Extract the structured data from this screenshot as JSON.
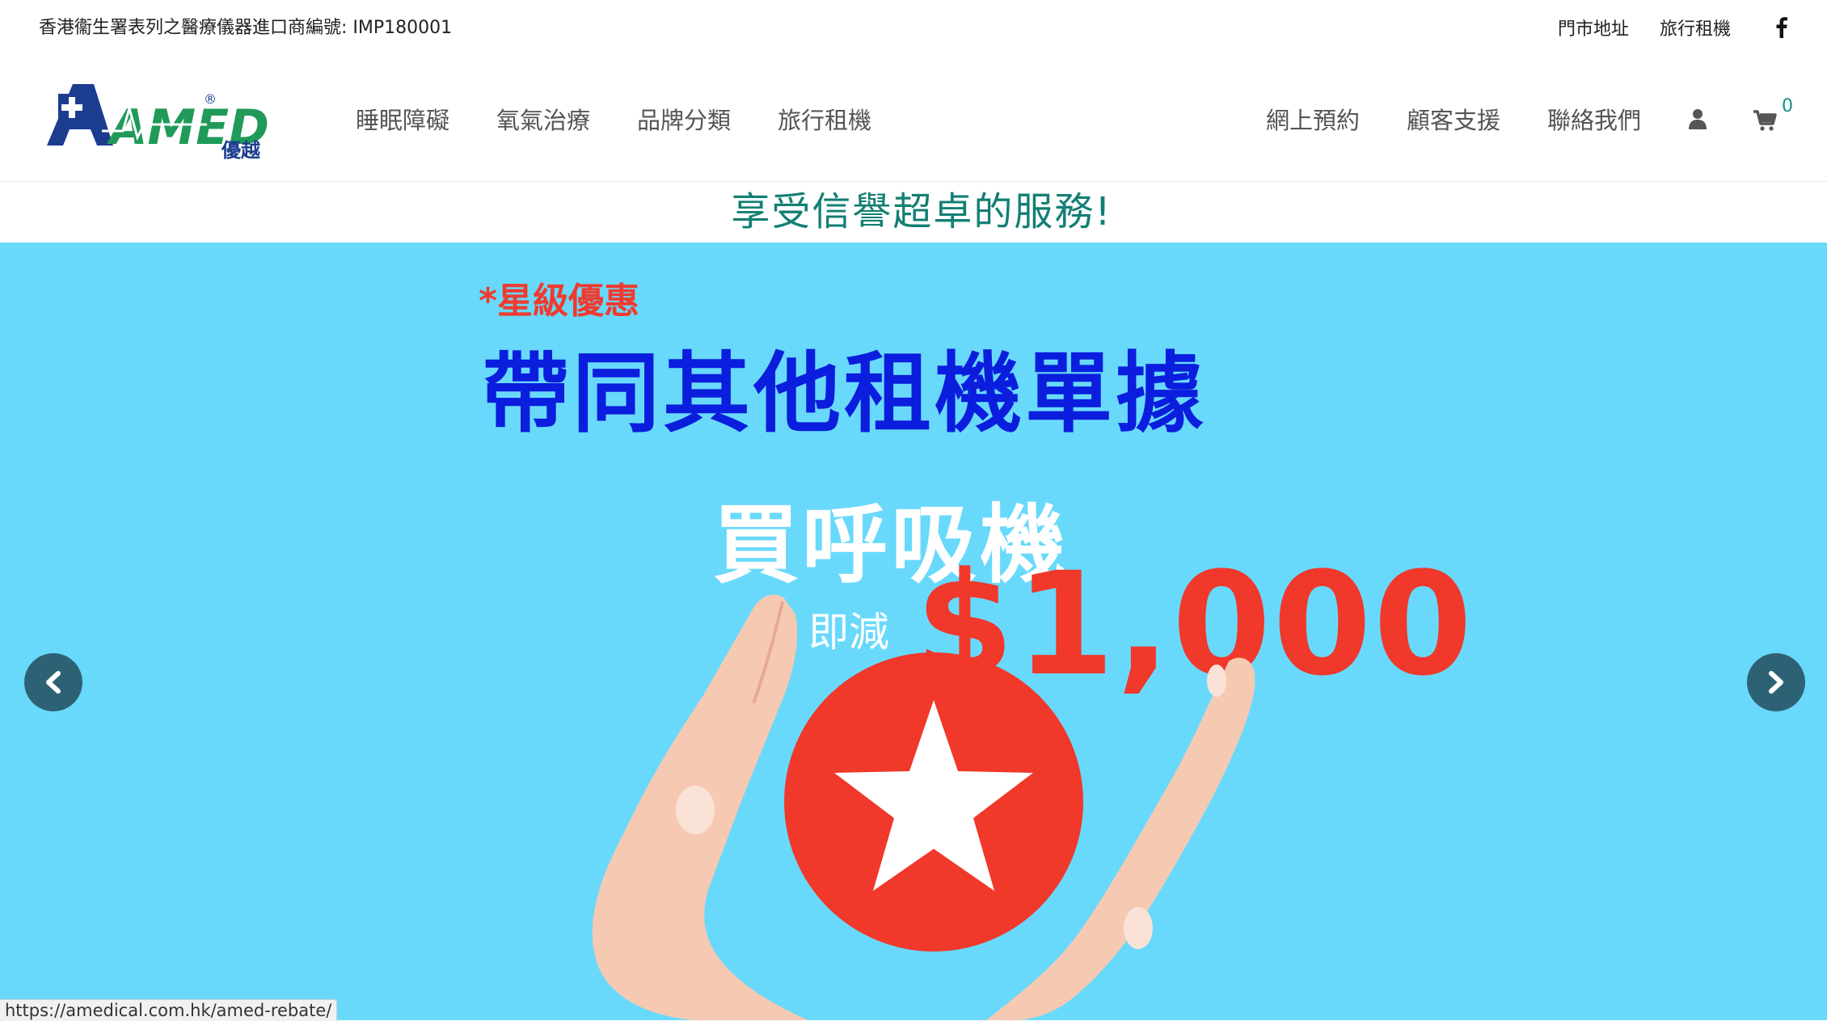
{
  "top_bar": {
    "notice": "香港衞生署表列之醫療儀器進口商編號: IMP180001",
    "links": [
      "門市地址",
      "旅行租機"
    ],
    "social_icon": "facebook-icon"
  },
  "header": {
    "logo": {
      "text": "AMED",
      "sub": "優越",
      "mark": "®"
    },
    "nav_left": [
      "睡眠障礙",
      "氧氣治療",
      "品牌分類",
      "旅行租機"
    ],
    "nav_right": [
      "網上預約",
      "顧客支援",
      "聯絡我們"
    ],
    "user_icon": "user-icon",
    "cart": {
      "icon": "cart-icon",
      "count": "0"
    }
  },
  "tagline": "享受信譽超卓的服務!",
  "hero": {
    "promo_tag": "*星級優惠",
    "headline": "帶同其他租機單據",
    "subheadline": "買呼吸機",
    "discount_label": "即減",
    "price": "$1,000",
    "prev_icon": "chevron-left-icon",
    "next_icon": "chevron-right-icon"
  },
  "status_bar": {
    "url": "https://amedical.com.hk/amed-rebate/"
  },
  "colors": {
    "hero_bg": "#69d9fb",
    "headline": "#0b1ddd",
    "accent_red": "#f0382b",
    "tagline": "#137f73",
    "arrow_bg": "#2d6275",
    "logo_blue": "#1c3d8f",
    "logo_green": "#1f9a58"
  }
}
